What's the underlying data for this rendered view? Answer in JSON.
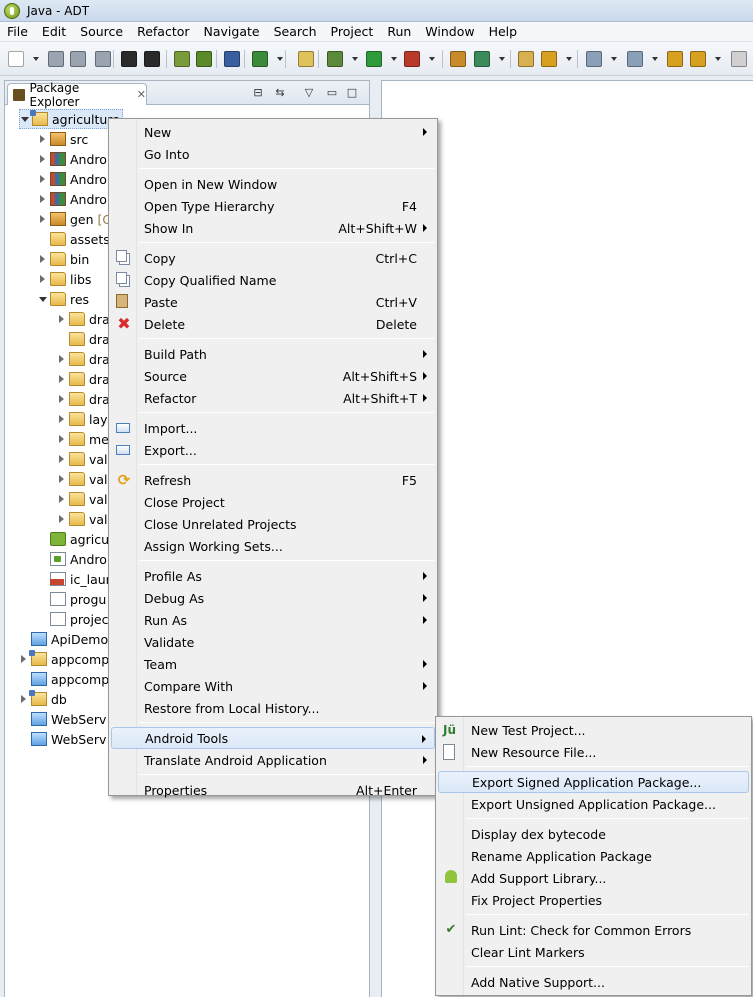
{
  "window": {
    "title": "Java - ADT"
  },
  "menubar": [
    "File",
    "Edit",
    "Source",
    "Refactor",
    "Navigate",
    "Search",
    "Project",
    "Run",
    "Window",
    "Help"
  ],
  "view": {
    "tab_label": "Package Explorer"
  },
  "tree": [
    {
      "label": "agriculture",
      "deco": "",
      "icon": "project-icon",
      "level": 0,
      "twisty": "open",
      "selected": true
    },
    {
      "label": "src",
      "deco": "",
      "icon": "package-folder-icon",
      "level": 1,
      "twisty": "closed"
    },
    {
      "label": "Andro",
      "deco": "",
      "icon": "library-icon",
      "level": 1,
      "twisty": "closed"
    },
    {
      "label": "Andro",
      "deco": "",
      "icon": "library-icon",
      "level": 1,
      "twisty": "closed"
    },
    {
      "label": "Andro",
      "deco": "",
      "icon": "library-icon",
      "level": 1,
      "twisty": "closed"
    },
    {
      "label": "gen",
      "deco": "[G",
      "icon": "package-folder-icon",
      "level": 1,
      "twisty": "closed"
    },
    {
      "label": "assets",
      "deco": "",
      "icon": "folder-icon",
      "level": 1,
      "twisty": "none"
    },
    {
      "label": "bin",
      "deco": "",
      "icon": "folder-icon",
      "level": 1,
      "twisty": "closed"
    },
    {
      "label": "libs",
      "deco": "",
      "icon": "folder-icon",
      "level": 1,
      "twisty": "closed"
    },
    {
      "label": "res",
      "deco": "",
      "icon": "folder-icon",
      "level": 1,
      "twisty": "open"
    },
    {
      "label": "dra",
      "deco": "",
      "icon": "folder-icon",
      "level": 2,
      "twisty": "closed"
    },
    {
      "label": "dra",
      "deco": "",
      "icon": "folder-icon",
      "level": 2,
      "twisty": "none"
    },
    {
      "label": "dra",
      "deco": "",
      "icon": "folder-icon",
      "level": 2,
      "twisty": "closed"
    },
    {
      "label": "dra",
      "deco": "",
      "icon": "folder-icon",
      "level": 2,
      "twisty": "closed"
    },
    {
      "label": "dra",
      "deco": "",
      "icon": "folder-icon",
      "level": 2,
      "twisty": "closed"
    },
    {
      "label": "lay",
      "deco": "",
      "icon": "folder-icon",
      "level": 2,
      "twisty": "closed"
    },
    {
      "label": "me",
      "deco": "",
      "icon": "folder-icon",
      "level": 2,
      "twisty": "closed"
    },
    {
      "label": "val",
      "deco": "",
      "icon": "folder-icon",
      "level": 2,
      "twisty": "closed"
    },
    {
      "label": "val",
      "deco": "",
      "icon": "folder-icon",
      "level": 2,
      "twisty": "closed"
    },
    {
      "label": "val",
      "deco": "",
      "icon": "folder-icon",
      "level": 2,
      "twisty": "closed"
    },
    {
      "label": "val",
      "deco": "",
      "icon": "folder-icon",
      "level": 2,
      "twisty": "closed"
    },
    {
      "label": "agricu",
      "deco": "",
      "icon": "apk-icon",
      "level": 1,
      "twisty": "none"
    },
    {
      "label": "Andro",
      "deco": "",
      "icon": "xml-file-icon",
      "level": 1,
      "twisty": "none"
    },
    {
      "label": "ic_laur",
      "deco": "",
      "icon": "png-file-icon",
      "level": 1,
      "twisty": "none"
    },
    {
      "label": "progu",
      "deco": "",
      "icon": "file-icon",
      "level": 1,
      "twisty": "none"
    },
    {
      "label": "projec",
      "deco": "",
      "icon": "file-icon",
      "level": 1,
      "twisty": "none"
    },
    {
      "label": "ApiDemo",
      "deco": "",
      "icon": "closed-project-icon",
      "level": 0,
      "twisty": "none"
    },
    {
      "label": "appcomp",
      "deco": "",
      "icon": "project-icon",
      "level": 0,
      "twisty": "closed"
    },
    {
      "label": "appcomp",
      "deco": "",
      "icon": "closed-project-icon",
      "level": 0,
      "twisty": "none"
    },
    {
      "label": "db",
      "deco": "",
      "icon": "project-icon",
      "level": 0,
      "twisty": "closed"
    },
    {
      "label": "WebServ",
      "deco": "",
      "icon": "closed-project-icon",
      "level": 0,
      "twisty": "none"
    },
    {
      "label": "WebServ",
      "deco": "",
      "icon": "closed-project-icon",
      "level": 0,
      "twisty": "none"
    }
  ],
  "context_menu": [
    {
      "label": "New",
      "shortcut": "",
      "submenu": true,
      "icon": ""
    },
    {
      "label": "Go Into",
      "shortcut": "",
      "submenu": false,
      "icon": ""
    },
    {
      "sep": true
    },
    {
      "label": "Open in New Window",
      "shortcut": "",
      "submenu": false,
      "icon": ""
    },
    {
      "label": "Open Type Hierarchy",
      "shortcut": "F4",
      "submenu": false,
      "icon": ""
    },
    {
      "label": "Show In",
      "shortcut": "Alt+Shift+W",
      "submenu": true,
      "icon": ""
    },
    {
      "sep": true
    },
    {
      "label": "Copy",
      "shortcut": "Ctrl+C",
      "submenu": false,
      "icon": "copy-icon"
    },
    {
      "label": "Copy Qualified Name",
      "shortcut": "",
      "submenu": false,
      "icon": "copy-icon"
    },
    {
      "label": "Paste",
      "shortcut": "Ctrl+V",
      "submenu": false,
      "icon": "paste-icon"
    },
    {
      "label": "Delete",
      "shortcut": "Delete",
      "submenu": false,
      "icon": "delete-icon"
    },
    {
      "sep": true
    },
    {
      "label": "Build Path",
      "shortcut": "",
      "submenu": true,
      "icon": ""
    },
    {
      "label": "Source",
      "shortcut": "Alt+Shift+S",
      "submenu": true,
      "icon": ""
    },
    {
      "label": "Refactor",
      "shortcut": "Alt+Shift+T",
      "submenu": true,
      "icon": ""
    },
    {
      "sep": true
    },
    {
      "label": "Import...",
      "shortcut": "",
      "submenu": false,
      "icon": "import-icon"
    },
    {
      "label": "Export...",
      "shortcut": "",
      "submenu": false,
      "icon": "export-icon"
    },
    {
      "sep": true
    },
    {
      "label": "Refresh",
      "shortcut": "F5",
      "submenu": false,
      "icon": "refresh-icon"
    },
    {
      "label": "Close Project",
      "shortcut": "",
      "submenu": false,
      "icon": ""
    },
    {
      "label": "Close Unrelated Projects",
      "shortcut": "",
      "submenu": false,
      "icon": ""
    },
    {
      "label": "Assign Working Sets...",
      "shortcut": "",
      "submenu": false,
      "icon": ""
    },
    {
      "sep": true
    },
    {
      "label": "Profile As",
      "shortcut": "",
      "submenu": true,
      "icon": ""
    },
    {
      "label": "Debug As",
      "shortcut": "",
      "submenu": true,
      "icon": ""
    },
    {
      "label": "Run As",
      "shortcut": "",
      "submenu": true,
      "icon": ""
    },
    {
      "label": "Validate",
      "shortcut": "",
      "submenu": false,
      "icon": ""
    },
    {
      "label": "Team",
      "shortcut": "",
      "submenu": true,
      "icon": ""
    },
    {
      "label": "Compare With",
      "shortcut": "",
      "submenu": true,
      "icon": ""
    },
    {
      "label": "Restore from Local History...",
      "shortcut": "",
      "submenu": false,
      "icon": ""
    },
    {
      "sep": true
    },
    {
      "label": "Android Tools",
      "shortcut": "",
      "submenu": true,
      "icon": "",
      "highlighted": true
    },
    {
      "label": "Translate Android Application",
      "shortcut": "",
      "submenu": true,
      "icon": ""
    },
    {
      "sep": true
    },
    {
      "label": "Properties",
      "shortcut": "Alt+Enter",
      "submenu": false,
      "icon": ""
    }
  ],
  "android_tools_menu": [
    {
      "label": "New Test Project...",
      "icon": "junit-icon"
    },
    {
      "label": "New Resource File...",
      "icon": "new-resource-icon"
    },
    {
      "sep": true
    },
    {
      "label": "Export Signed Application Package...",
      "icon": "",
      "highlighted": true
    },
    {
      "label": "Export Unsigned Application Package...",
      "icon": ""
    },
    {
      "sep": true
    },
    {
      "label": "Display dex bytecode",
      "icon": ""
    },
    {
      "label": "Rename Application Package",
      "icon": ""
    },
    {
      "label": "Add Support Library...",
      "icon": "android-icon"
    },
    {
      "label": "Fix Project Properties",
      "icon": ""
    },
    {
      "sep": true
    },
    {
      "label": "Run Lint: Check for Common Errors",
      "icon": "check-icon"
    },
    {
      "label": "Clear Lint Markers",
      "icon": ""
    },
    {
      "sep": true
    },
    {
      "label": "Add Native Support...",
      "icon": ""
    }
  ]
}
